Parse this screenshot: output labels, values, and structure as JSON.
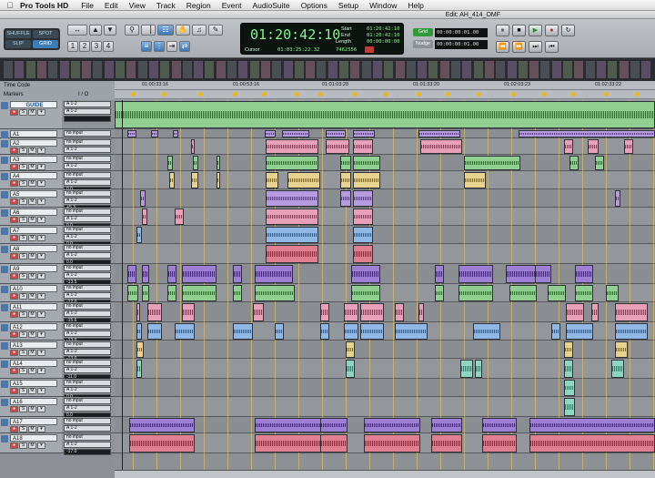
{
  "menubar": {
    "apple": "",
    "app": "Pro Tools HD",
    "items": [
      "File",
      "Edit",
      "View",
      "Track",
      "Region",
      "Event",
      "AudioSuite",
      "Options",
      "Setup",
      "Window",
      "Help"
    ]
  },
  "window": {
    "title": "Edit: AH_414_OMF"
  },
  "modes": [
    "SHUFFLE",
    "SPOT",
    "SLIP",
    "GRID"
  ],
  "counter": {
    "main": "01:20:42:10",
    "start_label": "Start",
    "start": "01:20:42:10",
    "end_label": "End",
    "end": "01:20:42:10",
    "length_label": "Length",
    "length": "00:00:00:00",
    "cursor_label": "Cursor",
    "cursor": "01:03:25:22.32",
    "sample": "7462556"
  },
  "grid": {
    "grid_label": "Grid",
    "grid_value": "00:00:00:01.00",
    "nudge_label": "Nudge",
    "nudge_value": "00:00:00:01.00"
  },
  "rulers": {
    "timecode_label": "Time Code",
    "markers_label": "Markers",
    "io_header": "I / O",
    "timecodes": [
      "01:00:33:16",
      "01:00:53:16",
      "01:01:03:28",
      "01:01:33:20",
      "01:02:03:23",
      "01:02:33:22"
    ]
  },
  "tracks": [
    {
      "name": "GUIDE",
      "input": "A 1-2",
      "output": "A 1-2",
      "vol": ""
    },
    {
      "name": "A1",
      "input": "no input",
      "output": "A 1-2",
      "vol": "-11.4"
    },
    {
      "name": "A2",
      "input": "no input",
      "output": "A 1-2",
      "vol": "0.0"
    },
    {
      "name": "A3",
      "input": "no input",
      "output": "A 1-2",
      "vol": "0.0"
    },
    {
      "name": "A4",
      "input": "no input",
      "output": "A 1-2",
      "vol": "0.0"
    },
    {
      "name": "A5",
      "input": "no input",
      "output": "A 1-2",
      "vol": "+5.3"
    },
    {
      "name": "A6",
      "input": "no input",
      "output": "A 1-2",
      "vol": "0.0"
    },
    {
      "name": "A7",
      "input": "no input",
      "output": "A 1-2",
      "vol": "0.0"
    },
    {
      "name": "A8",
      "input": "no input",
      "output": "A 1-2",
      "vol": "0.0"
    },
    {
      "name": "A9",
      "input": "no input",
      "output": "A 1-2",
      "vol": "-13.5"
    },
    {
      "name": "A10",
      "input": "no input",
      "output": "A 1-2",
      "vol": "-12.0"
    },
    {
      "name": "A11",
      "input": "no input",
      "output": "A 1-2",
      "vol": "-15.6"
    },
    {
      "name": "A12",
      "input": "no input",
      "output": "A 1-2",
      "vol": "-13.0"
    },
    {
      "name": "A13",
      "input": "no input",
      "output": "A 1-2",
      "vol": "-13.0"
    },
    {
      "name": "A14",
      "input": "no input",
      "output": "A 1-2",
      "vol": "-11.0"
    },
    {
      "name": "A15",
      "input": "no input",
      "output": "A 1-2",
      "vol": "0.0"
    },
    {
      "name": "A16",
      "input": "no input",
      "output": "A 1-2",
      "vol": "0.0"
    },
    {
      "name": "A17",
      "input": "no input",
      "output": "A 1-2",
      "vol": "-17.0"
    },
    {
      "name": "A18",
      "input": "no input",
      "output": "A 1-2",
      "vol": "-17.0"
    }
  ],
  "colors": {
    "green": "#8fcf8f",
    "purple": "#b79be0",
    "pink": "#e8a0b8",
    "blue": "#8fb8e6",
    "yellow": "#e8d28f",
    "teal": "#8fd6c0",
    "violet": "#9d7fd6",
    "red": "#e07f8f"
  }
}
